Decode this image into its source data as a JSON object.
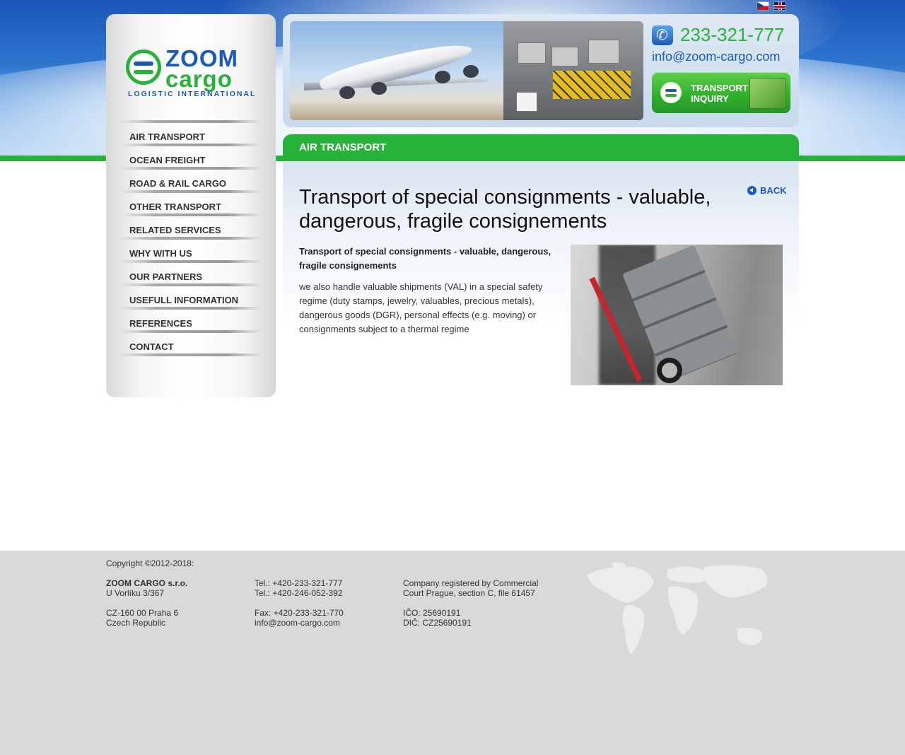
{
  "languages": [
    {
      "name": "czech-flag",
      "code": "cz"
    },
    {
      "name": "english-flag",
      "code": "en"
    }
  ],
  "logo": {
    "word1": "ZOOM",
    "word2": "cargo",
    "tagline": "LOGISTIC INTERNATIONAL"
  },
  "nav": {
    "items": [
      {
        "label": "AIR TRANSPORT"
      },
      {
        "label": "OCEAN FREIGHT"
      },
      {
        "label": "ROAD & RAIL CARGO"
      },
      {
        "label": "OTHER TRANSPORT"
      },
      {
        "label": "RELATED SERVICES"
      },
      {
        "label": "WHY WITH US"
      },
      {
        "label": "OUR PARTNERS"
      },
      {
        "label": "USEFULL INFORMATION"
      },
      {
        "label": "REFERENCES"
      },
      {
        "label": "CONTACT"
      }
    ]
  },
  "header": {
    "phone": "233-321-777",
    "email": "info@zoom-cargo.com",
    "inquiry_line1": "TRANSPORT",
    "inquiry_line2": "INQUIRY"
  },
  "content": {
    "section_title": "AIR TRANSPORT",
    "back_label": "BACK",
    "title": "Transport of special consignments - valuable, dangerous, fragile consignements",
    "lead": "Transport of special consignments - valuable, dangerous, fragile consignements",
    "body": "we also handle valuable shipments (VAL) in a special safety regime (duty stamps, jewelry, valuables, precious metals), dangerous goods (DGR), personal effects (e.g. moving) or consignments subject to a thermal regime"
  },
  "footer": {
    "copyright": "Copyright ©2012-2018:",
    "company": "ZOOM CARGO s.r.o.",
    "street": "U Vorlíku 3/367",
    "city": "CZ-160 00 Praha 6",
    "country": "Czech Republic",
    "tel1": "Tel.: +420-233-321-777",
    "tel2": "Tel.: +420-246-052-392",
    "fax": "Fax: +420-233-321-770",
    "email": "info@zoom-cargo.com",
    "registry1": "Company registered by Commercial",
    "registry2": "Court Prague, section C, file 61457",
    "ico": "IČO: 25690191",
    "dic": "DIČ: CZ25690191"
  },
  "colors": {
    "brand_green": "#27b33a",
    "brand_blue": "#1c5ab8",
    "footer_bg": "#d9d9d7"
  }
}
